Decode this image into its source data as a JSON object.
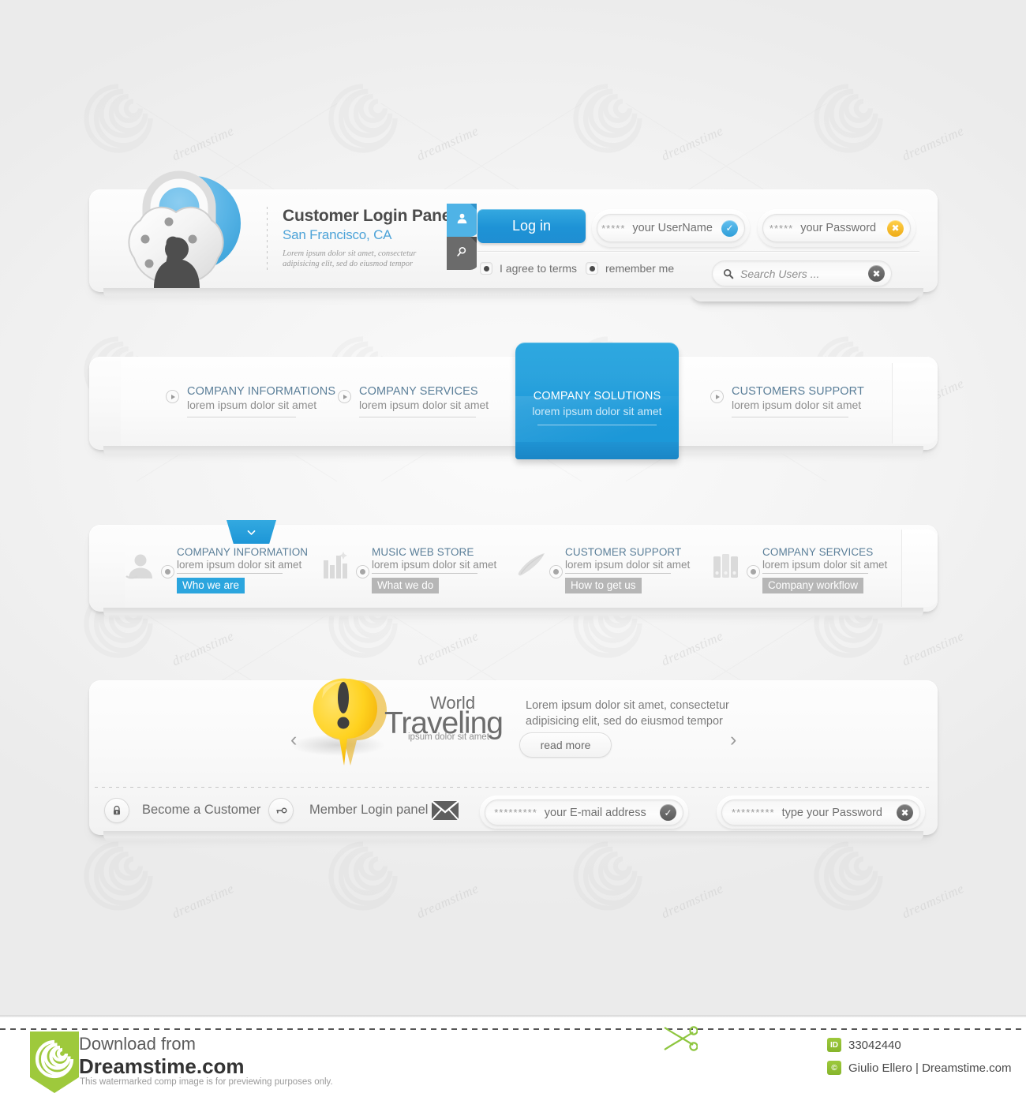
{
  "login": {
    "title": "Customer Login Panel",
    "subtitle": "San Francisco, CA",
    "description": "Lorem ipsum dolor sit amet, consectetur adipisicing elit, sed do eiusmod tempor",
    "login_button": "Log in",
    "username_field": {
      "stars": "*****",
      "label": "your UserName",
      "badge": "check"
    },
    "password_field": {
      "stars": "*****",
      "label": "your Password",
      "badge": "cross"
    },
    "agree_checkbox": "I agree to terms",
    "remember_checkbox": "remember me",
    "search_placeholder": "Search Users ...",
    "tabs": [
      "user-icon",
      "search-icon"
    ]
  },
  "nav_solutions": {
    "items": [
      {
        "title": "COMPANY INFORMATIONS",
        "sub": "lorem ipsum dolor sit amet",
        "active": false
      },
      {
        "title": "COMPANY SERVICES",
        "sub": "lorem ipsum dolor sit amet",
        "active": false
      },
      {
        "title": "COMPANY SOLUTIONS",
        "sub": "lorem ipsum dolor sit amet",
        "active": true
      },
      {
        "title": "CUSTOMERS SUPPORT",
        "sub": "lorem ipsum dolor sit amet",
        "active": false
      }
    ]
  },
  "nav_icons": {
    "items": [
      {
        "title": "COMPANY INFORMATION",
        "sub": "lorem ipsum dolor sit amet",
        "chip": "Who we are",
        "icon": "user-portrait-icon",
        "active": true
      },
      {
        "title": "MUSIC WEB STORE",
        "sub": "lorem ipsum dolor sit amet",
        "chip": "What we do",
        "icon": "equalizer-icon",
        "active": false
      },
      {
        "title": "CUSTOMER SUPPORT",
        "sub": "lorem ipsum dolor sit amet",
        "chip": "How to get us",
        "icon": "feather-icon",
        "active": false
      },
      {
        "title": "COMPANY SERVICES",
        "sub": "lorem ipsum dolor sit amet",
        "chip": "Company workflow",
        "icon": "binders-icon",
        "active": false
      }
    ]
  },
  "banner": {
    "word_small": "World",
    "word_big": "Traveling",
    "word_tiny": "ipsum dolor sit amet",
    "description": "Lorem ipsum dolor sit amet, consectetur adipisicing elit, sed do eiusmod tempor",
    "read_more": "read more",
    "prev_arrow": "‹",
    "next_arrow": "›"
  },
  "member_bar": {
    "become_customer": "Become a Customer",
    "member_login": "Member Login panel",
    "email_field": {
      "stars": "*********",
      "label": "your E-mail address",
      "badge": "check"
    },
    "password_field": {
      "stars": "*********",
      "label": "type your Password",
      "badge": "cross"
    }
  },
  "footer": {
    "download_from": "Download from",
    "site": "Dreamstime.com",
    "note": "This watermarked comp image is for previewing purposes only.",
    "id_badge": "ID",
    "id_value": "33042440",
    "copy_badge": "©",
    "author": "Giulio Ellero | Dreamstime.com"
  },
  "watermark": {
    "text": "dreamstime"
  },
  "colors": {
    "accent_blue": "#1e9ada",
    "link_blue": "#4da3d8",
    "title_gray": "#4b4b4b",
    "body_gray": "#8e8e8e",
    "yellow": "#f5c320",
    "green": "#9ec93c",
    "chip_gray": "#b6b6b6",
    "background": "#f2f2f2"
  }
}
